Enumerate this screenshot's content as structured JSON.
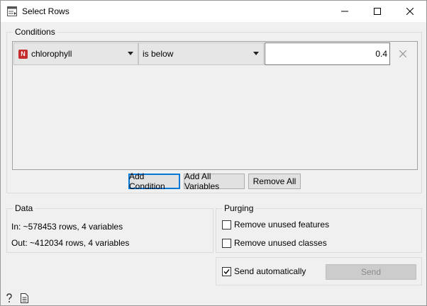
{
  "window": {
    "title": "Select Rows",
    "icon": "select-rows-widget-icon",
    "controls": [
      "minimize-icon",
      "maximize-icon",
      "close-icon"
    ]
  },
  "conditions": {
    "group_title": "Conditions",
    "rows": [
      {
        "variable_type_badge": "N",
        "variable": "chlorophyll",
        "operator": "is below",
        "value": "0.4"
      }
    ],
    "buttons": {
      "add_condition": "Add Condition",
      "add_all_variables": "Add All Variables",
      "remove_all": "Remove All"
    }
  },
  "data": {
    "group_title": "Data",
    "in_text": "In: ~578453 rows, 4 variables",
    "out_text": "Out: ~412034 rows, 4 variables"
  },
  "purging": {
    "group_title": "Purging",
    "remove_unused_features": {
      "label": "Remove unused features",
      "checked": false
    },
    "remove_unused_classes": {
      "label": "Remove unused classes",
      "checked": false
    }
  },
  "send": {
    "send_automatically": {
      "label": "Send automatically",
      "checked": true
    },
    "send_button": "Send"
  },
  "status_bar": {
    "icons": [
      "help-icon",
      "report-icon"
    ]
  },
  "colors": {
    "numeric_badge": "#c62d2d",
    "focus_border": "#0078d7",
    "window_bg": "#f0f0f0"
  }
}
